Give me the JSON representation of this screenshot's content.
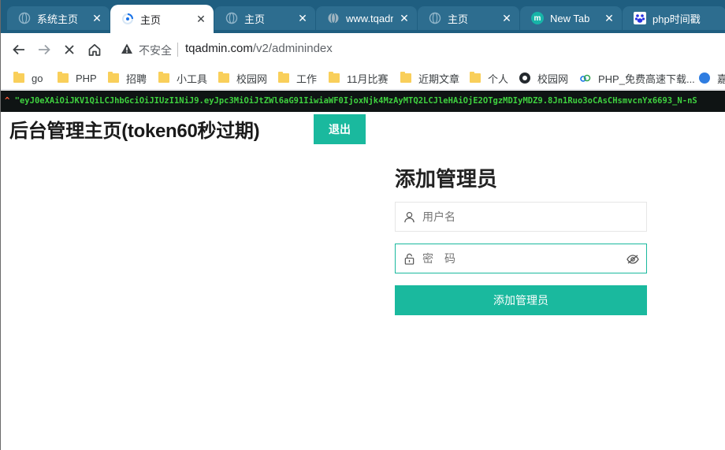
{
  "browser": {
    "tabs": [
      {
        "title": "系统主页",
        "favicon": "globe-icon"
      },
      {
        "title": "主页",
        "favicon": "loading-spinner-icon",
        "active": true
      },
      {
        "title": "主页",
        "favicon": "globe-icon"
      },
      {
        "title": "www.tqadm",
        "favicon": "globe-icon"
      },
      {
        "title": "主页",
        "favicon": "globe-icon"
      },
      {
        "title": "New Tab",
        "favicon": "m-logo-icon"
      },
      {
        "title": "php时间戳",
        "favicon": "baidu-icon"
      }
    ],
    "address": {
      "security_label": "不安全",
      "host": "tqadmin.com",
      "path": "/v2/adminindex"
    },
    "bookmarks": [
      {
        "label": "go",
        "icon": "folder-icon"
      },
      {
        "label": "PHP",
        "icon": "folder-icon"
      },
      {
        "label": "招聘",
        "icon": "folder-icon"
      },
      {
        "label": "小工具",
        "icon": "folder-icon"
      },
      {
        "label": "校园网",
        "icon": "folder-icon"
      },
      {
        "label": "工作",
        "icon": "folder-icon"
      },
      {
        "label": "11月比赛",
        "icon": "folder-icon"
      },
      {
        "label": "近期文章",
        "icon": "folder-icon"
      },
      {
        "label": "个人",
        "icon": "folder-icon"
      },
      {
        "label": "校园网",
        "icon": "github-icon"
      },
      {
        "label": "PHP_免费高速下载...",
        "icon": "cloud-icon"
      },
      {
        "label": "嘉",
        "icon": "blue-circle-icon"
      }
    ],
    "colors": {
      "tabstrip": "#1f5e80",
      "accent": "#1ab99e"
    }
  },
  "token_bar": {
    "caret": "^",
    "text": "\"eyJ0eXAiOiJKV1QiLCJhbGciOiJIUzI1NiJ9.eyJpc3MiOiJtZWl6aG91IiwiaWF0IjoxNjk4MzAyMTQ2LCJleHAiOjE2OTgzMDIyMDZ9.8Jn1Ruo3oCAsCHsmvcnYx6693_N-nS"
  },
  "page": {
    "title": "后台管理主页(token60秒过期)",
    "logout_label": "退出",
    "form": {
      "title": "添加管理员",
      "username_placeholder": "用户名",
      "password_placeholder": "密　码",
      "submit_label": "添加管理员"
    }
  }
}
